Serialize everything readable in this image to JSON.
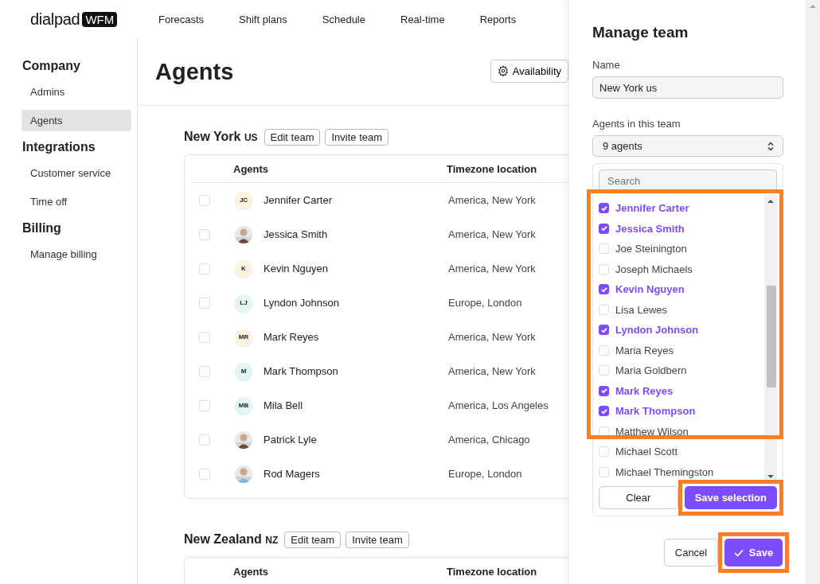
{
  "nav": {
    "logo": "dialpad",
    "logo_badge": "WFM",
    "items": [
      "Forecasts",
      "Shift plans",
      "Schedule",
      "Real-time",
      "Reports"
    ]
  },
  "sidebar": [
    {
      "title": "Company",
      "items": [
        {
          "label": "Admins",
          "selected": false
        },
        {
          "label": "Agents",
          "selected": true
        }
      ]
    },
    {
      "title": "Integrations",
      "items": [
        {
          "label": "Customer service",
          "selected": false
        },
        {
          "label": "Time off",
          "selected": false
        }
      ]
    },
    {
      "title": "Billing",
      "items": [
        {
          "label": "Manage billing",
          "selected": false
        }
      ]
    }
  ],
  "page": {
    "title": "Agents",
    "action": "Availability"
  },
  "teams": [
    {
      "name": "New York",
      "code": "US",
      "edit": "Edit team",
      "invite": "Invite team",
      "columns": [
        "Agents",
        "Timezone location"
      ],
      "rows": [
        {
          "name": "Jennifer Carter",
          "timezone": "America, New York",
          "checked": false,
          "avatar": {
            "kind": "initials",
            "initials": "JC",
            "color": "#fdf3e1"
          }
        },
        {
          "name": "Jessica Smith",
          "timezone": "America, New York",
          "checked": false
        },
        {
          "name": "Kevin Nguyen",
          "timezone": "America, New York",
          "checked": false,
          "avatar": {
            "kind": "initials",
            "initials": "K",
            "color": "#fdf3e1"
          }
        },
        {
          "name": "Lyndon Johnson",
          "timezone": "Europe, London",
          "checked": false,
          "avatar": {
            "kind": "initials",
            "initials": "LJ",
            "color": "#e2f6f3"
          }
        },
        {
          "name": "Mark Reyes",
          "timezone": "America, New York",
          "checked": false,
          "avatar": {
            "kind": "initials",
            "initials": "MR",
            "color": "#fdf3e1"
          }
        },
        {
          "name": "Mark Thompson",
          "timezone": "America, New York",
          "checked": false,
          "avatar": {
            "kind": "initials",
            "initials": "M",
            "color": "#e2f6f3"
          }
        },
        {
          "name": "Mila Bell",
          "timezone": "America, Los Angeles",
          "checked": false,
          "avatar": {
            "kind": "initials",
            "initials": "MB",
            "color": "#e2f6f3"
          }
        },
        {
          "name": "Patrick Lyle",
          "timezone": "America, Chicago",
          "checked": false
        },
        {
          "name": "Rod Magers",
          "timezone": "Europe, London",
          "checked": false
        }
      ]
    },
    {
      "name": "New Zealand",
      "code": "NZ",
      "edit": "Edit team",
      "invite": "Invite team",
      "columns": [
        "Agents",
        "Timezone location"
      ]
    }
  ],
  "panel": {
    "title": "Manage team",
    "name_label": "Name",
    "name_value": "New York us",
    "agents_label": "Agents in this team",
    "agents_select": "9 agents",
    "search_placeholder": "Search",
    "list_highlighted": true,
    "agents": [
      {
        "name": "Jennifer Carter",
        "checked": true
      },
      {
        "name": "Jessica Smith",
        "checked": true
      },
      {
        "name": "Joe Steinington",
        "checked": false
      },
      {
        "name": "Joseph Michaels",
        "checked": false
      },
      {
        "name": "Kevin Nguyen",
        "checked": true
      },
      {
        "name": "Lisa Lewes",
        "checked": false
      },
      {
        "name": "Lyndon Johnson",
        "checked": true
      },
      {
        "name": "Maria Reyes",
        "checked": false
      },
      {
        "name": "Maria Goldbern",
        "checked": false
      },
      {
        "name": "Mark Reyes",
        "checked": true
      },
      {
        "name": "Mark Thompson",
        "checked": true
      },
      {
        "name": "Matthew Wilson",
        "checked": false
      },
      {
        "name": "Michael Scott",
        "checked": false
      },
      {
        "name": "Michael Themingston",
        "checked": false
      }
    ],
    "clear": "Clear",
    "save_selection": {
      "label": "Save selection",
      "highlighted": true
    },
    "cancel": "Cancel",
    "save": {
      "label": "Save",
      "highlighted": true
    }
  }
}
